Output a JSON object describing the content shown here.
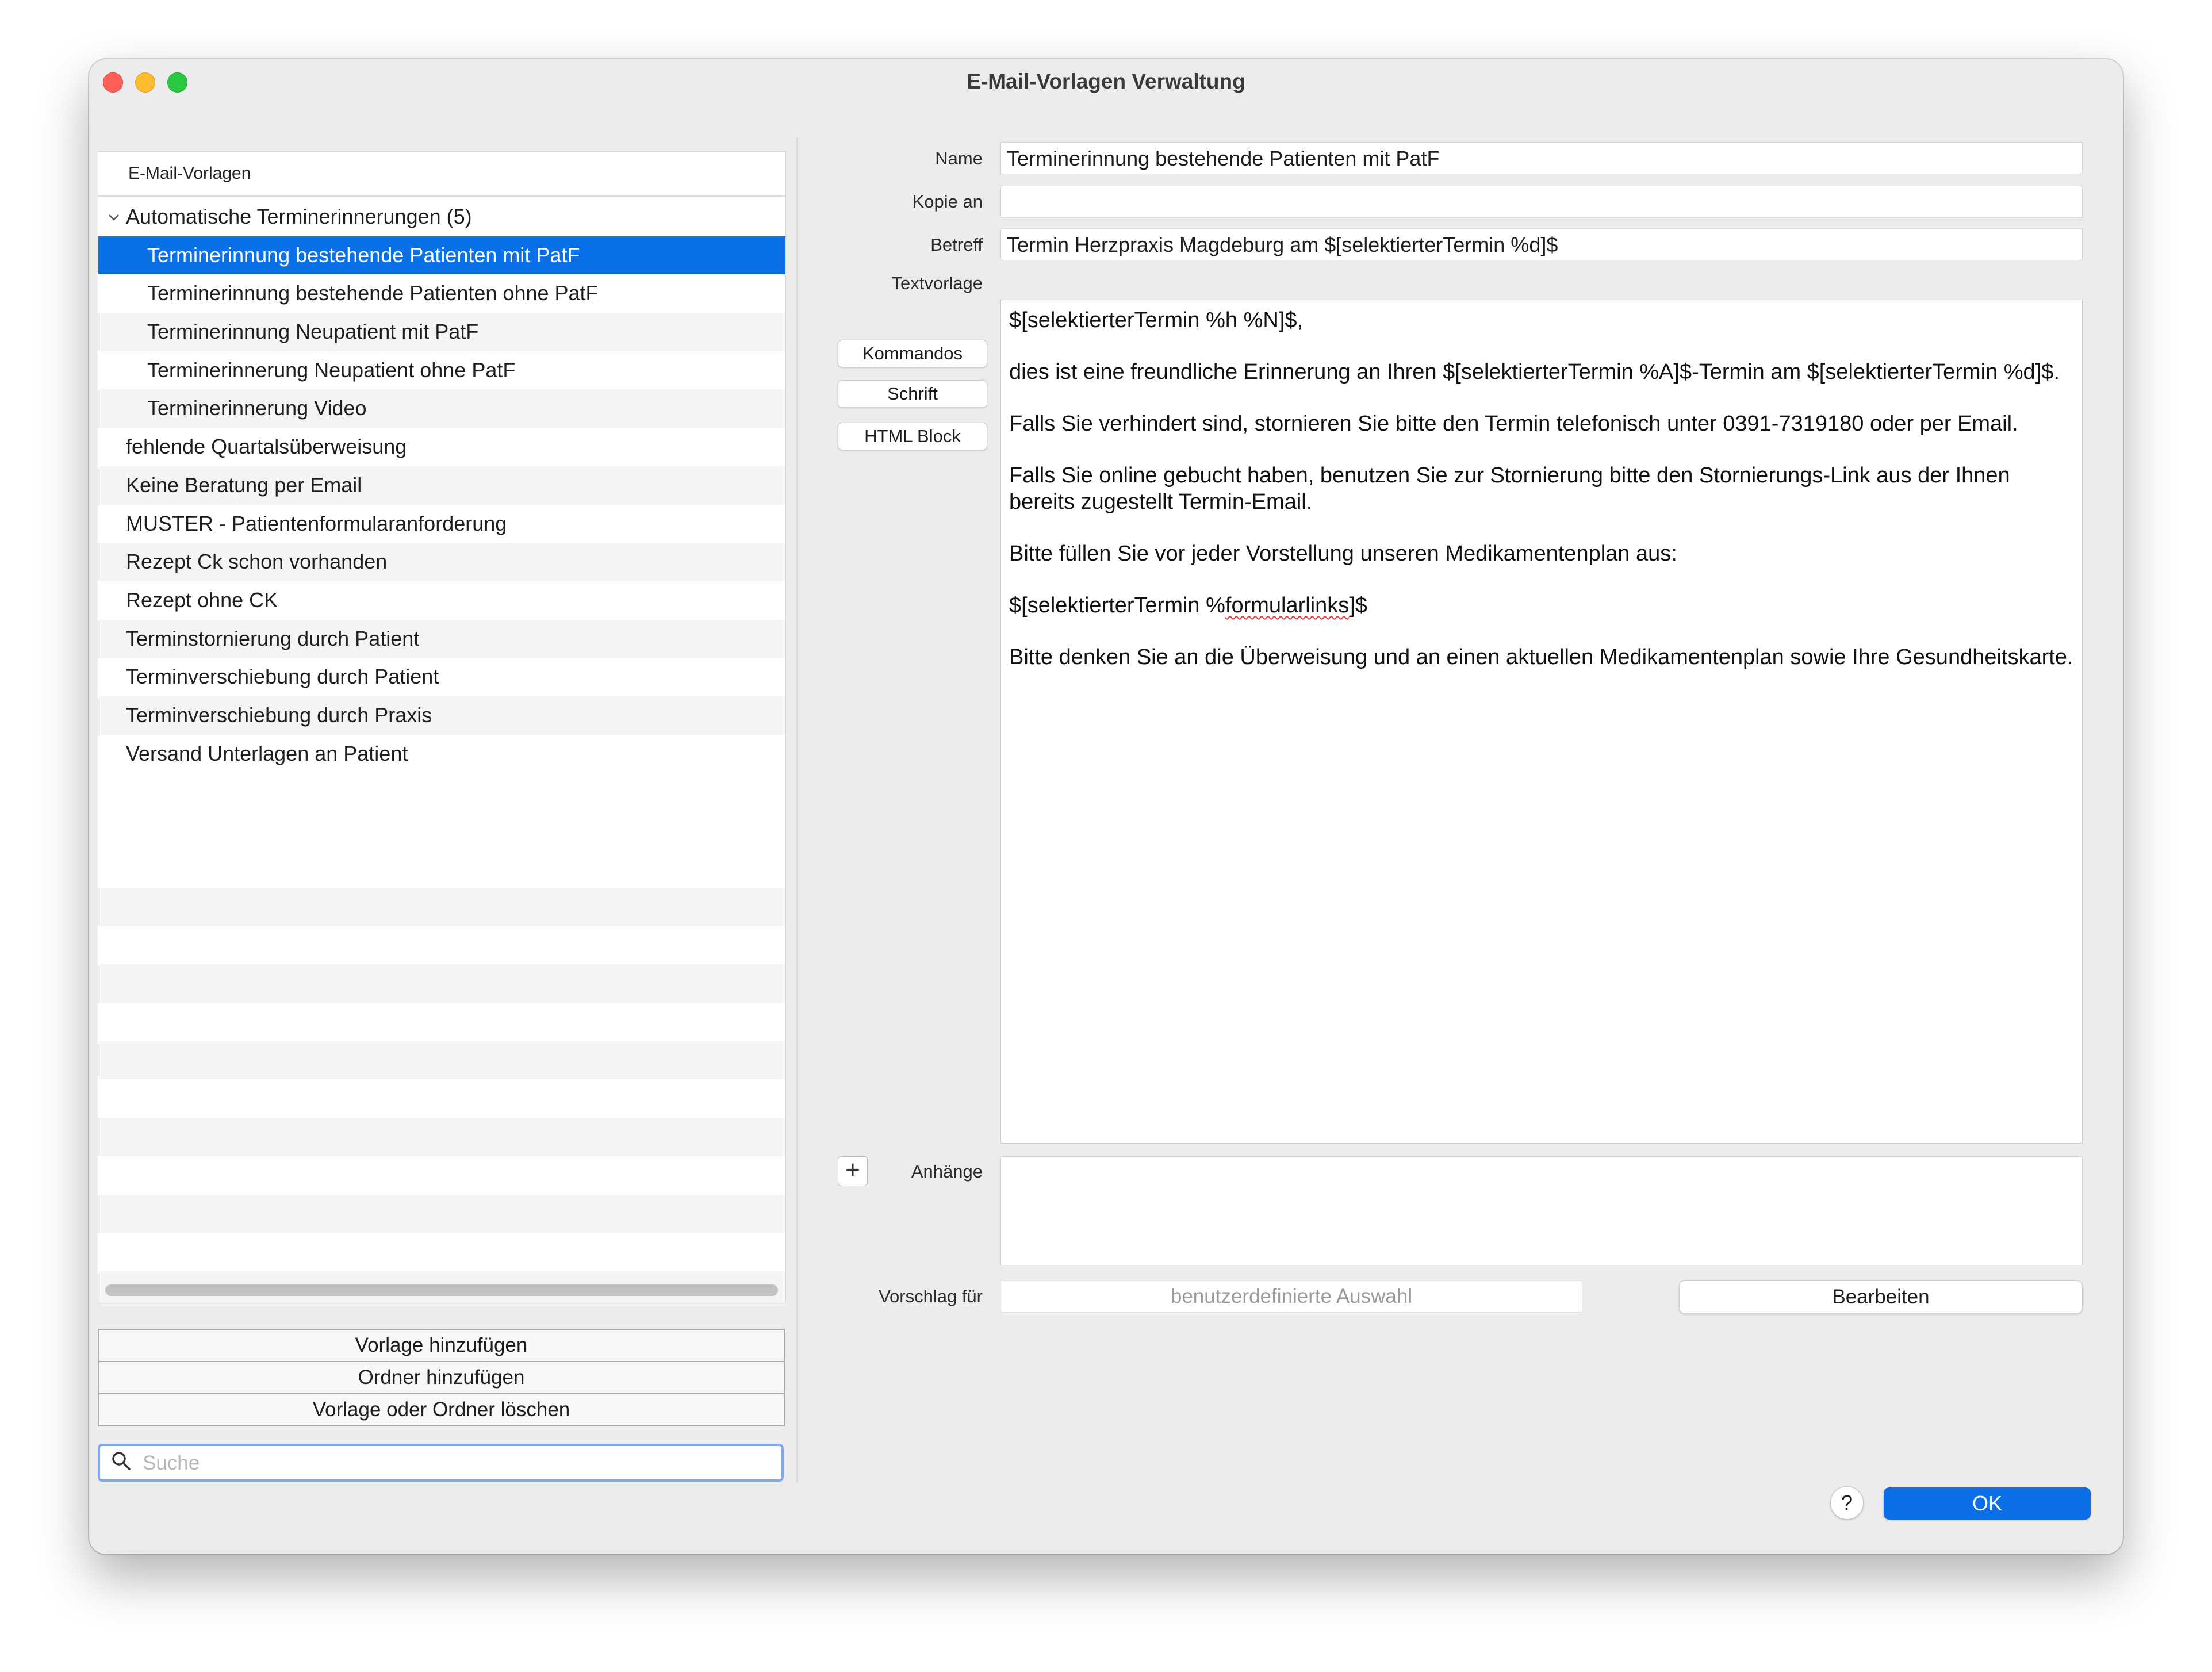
{
  "window": {
    "title": "E-Mail-Vorlagen Verwaltung"
  },
  "list": {
    "header": "E-Mail-Vorlagen",
    "items": [
      {
        "label": "Automatische Terminerinnerungen (5)",
        "level": 0,
        "folder": true,
        "expanded": true
      },
      {
        "label": "Terminerinnung bestehende Patienten mit PatF",
        "level": 1,
        "selected": true
      },
      {
        "label": "Terminerinnung bestehende Patienten ohne PatF",
        "level": 1
      },
      {
        "label": "Terminerinnung Neupatient mit PatF",
        "level": 1
      },
      {
        "label": "Terminerinnerung Neupatient ohne PatF",
        "level": 1
      },
      {
        "label": "Terminerinnerung Video",
        "level": 1
      },
      {
        "label": "fehlende Quartalsüberweisung",
        "level": 0
      },
      {
        "label": "Keine Beratung per Email",
        "level": 0
      },
      {
        "label": "MUSTER - Patientenformularanforderung",
        "level": 0
      },
      {
        "label": "Rezept Ck schon vorhanden",
        "level": 0
      },
      {
        "label": "Rezept ohne CK",
        "level": 0
      },
      {
        "label": "Terminstornierung durch Patient",
        "level": 0
      },
      {
        "label": "Terminverschiebung durch Patient",
        "level": 0
      },
      {
        "label": "Terminverschiebung durch Praxis",
        "level": 0
      },
      {
        "label": "Versand Unterlagen an Patient",
        "level": 0
      }
    ],
    "buttons": {
      "add_template": "Vorlage hinzufügen",
      "add_folder": "Ordner hinzufügen",
      "delete": "Vorlage oder Ordner löschen"
    },
    "search": {
      "placeholder": "Suche",
      "value": ""
    }
  },
  "form": {
    "name": {
      "label": "Name",
      "value": "Terminerinnung bestehende Patienten mit PatF"
    },
    "cc": {
      "label": "Kopie an",
      "value": ""
    },
    "subject": {
      "label": "Betreff",
      "value": "Termin Herzpraxis Magdeburg am $[selektierterTermin %d]$"
    },
    "body": {
      "label": "Textvorlage",
      "paragraphs": [
        "$[selektierterTermin %h %N]$,",
        "dies ist eine freundliche Erinnerung an Ihren $[selektierterTermin %A]$-Termin am $[selektierterTermin %d]$.",
        "Falls Sie verhindert sind, stornieren Sie bitte den Termin telefonisch unter 0391-7319180 oder per Email.",
        "Falls Sie online gebucht haben, benutzen Sie zur Stornierung bitte  den Stornierungs-Link aus der Ihnen bereits zugestellt Termin-Email.",
        "Bitte füllen Sie vor jeder Vorstellung unseren Medikamentenplan aus:",
        "Bitte denken Sie an die Überweisung und an einen aktuellen Medikamentenplan sowie Ihre Gesundheitskarte."
      ],
      "formular_prefix": "$[selektierterTermin %",
      "formular_word": "formularlinks",
      "formular_suffix": "]$"
    },
    "side_buttons": {
      "commands": "Kommandos",
      "font": "Schrift",
      "html_block": "HTML Block"
    },
    "attachments": {
      "label": "Anhänge",
      "add_symbol": "+"
    },
    "suggestion": {
      "label": "Vorschlag für",
      "value": "benutzerdefinierte Auswahl",
      "edit_button": "Bearbeiten"
    }
  },
  "footer": {
    "help": "?",
    "ok": "OK"
  },
  "colors": {
    "selection": "#0a70e8",
    "ok_button": "#0b6fe8",
    "focus_ring": "#7fa9ee"
  },
  "icons": {
    "search": "magnifier-icon",
    "disclosure": "chevron-down-icon",
    "add": "plus-icon"
  }
}
